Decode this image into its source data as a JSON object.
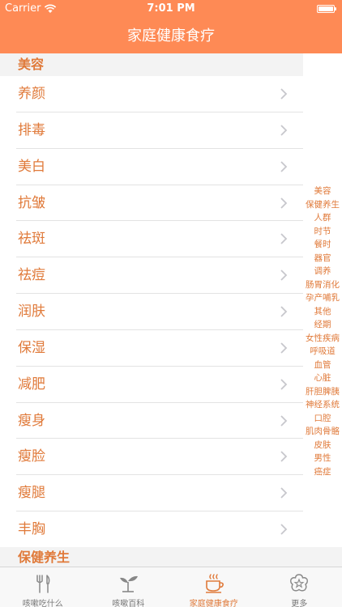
{
  "status_bar": {
    "carrier": "Carrier",
    "time": "7:01 PM"
  },
  "nav": {
    "title": "家庭健康食疗"
  },
  "sections": [
    {
      "title": "美容",
      "items": [
        "养颜",
        "排毒",
        "美白",
        "抗皱",
        "祛斑",
        "祛痘",
        "润肤",
        "保湿",
        "减肥",
        "瘦身",
        "瘦脸",
        "瘦腿",
        "丰胸"
      ]
    },
    {
      "title": "保健养生"
    }
  ],
  "index": [
    "美容",
    "保健养生",
    "人群",
    "时节",
    "餐时",
    "器官",
    "调养",
    "肠胃消化",
    "孕产哺乳",
    "其他",
    "经期",
    "女性疾病",
    "呼吸道",
    "血管",
    "心脏",
    "肝胆脾胰",
    "神经系统",
    "口腔",
    "肌肉骨骼",
    "皮肤",
    "男性",
    "癌症"
  ],
  "tabs": [
    {
      "label": "咳嗽吃什么",
      "icon": "fork-knife-icon"
    },
    {
      "label": "咳嗽百科",
      "icon": "sprout-icon"
    },
    {
      "label": "家庭健康食疗",
      "icon": "tea-cup-icon"
    },
    {
      "label": "更多",
      "icon": "flower-star-icon"
    }
  ],
  "colors": {
    "accent": "#fe8a55",
    "text_accent": "#e07a3a",
    "tab_inactive": "#777777"
  }
}
